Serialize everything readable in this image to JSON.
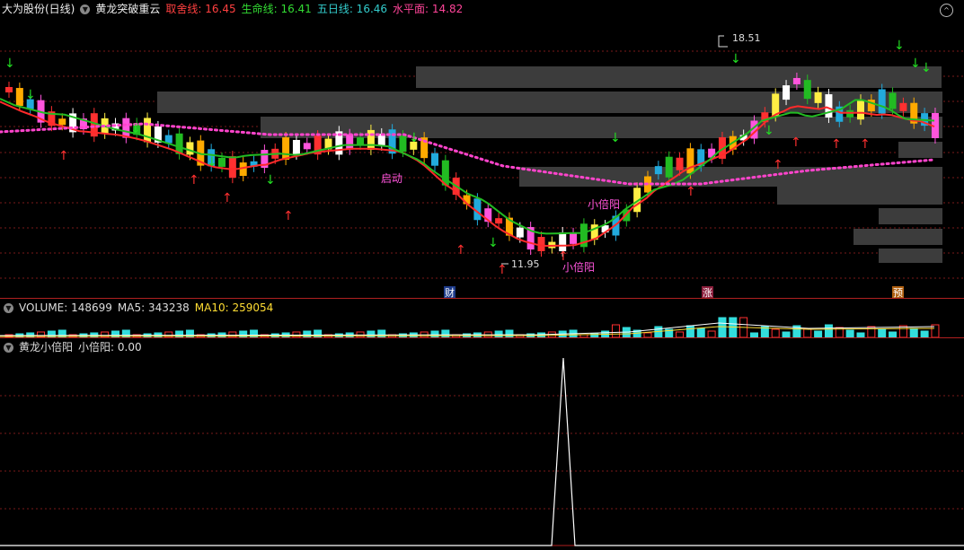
{
  "main": {
    "stock": "大为股份(日线)",
    "indicator": "黄龙突破重云",
    "items": [
      {
        "label": "取舍线:",
        "value": "16.45",
        "color": "#ff4040"
      },
      {
        "label": "生命线:",
        "value": "16.41",
        "color": "#33dd33"
      },
      {
        "label": "五日线:",
        "value": "16.46",
        "color": "#33cccc"
      },
      {
        "label": "水平面:",
        "value": "14.82",
        "color": "#ff4499"
      }
    ],
    "annotations": {
      "high": "18.51",
      "low": "11.95",
      "start": "启动",
      "xby1": "小倍阳",
      "xby2": "小倍阳"
    },
    "markers": {
      "cai": "财",
      "zhang": "涨",
      "yu": "预"
    }
  },
  "volume": {
    "title": "VOLUME: 148699",
    "ma5_label": "MA5: 343238",
    "ma10_label": "MA10: 259054"
  },
  "sub": {
    "title": "黄龙小倍阳",
    "value_label": "小倍阳: 0.00"
  },
  "colors": {
    "up": "#ff3030",
    "down": "#22bbbb",
    "grid": "#8a1f1f",
    "divider": "#aa2020"
  }
}
